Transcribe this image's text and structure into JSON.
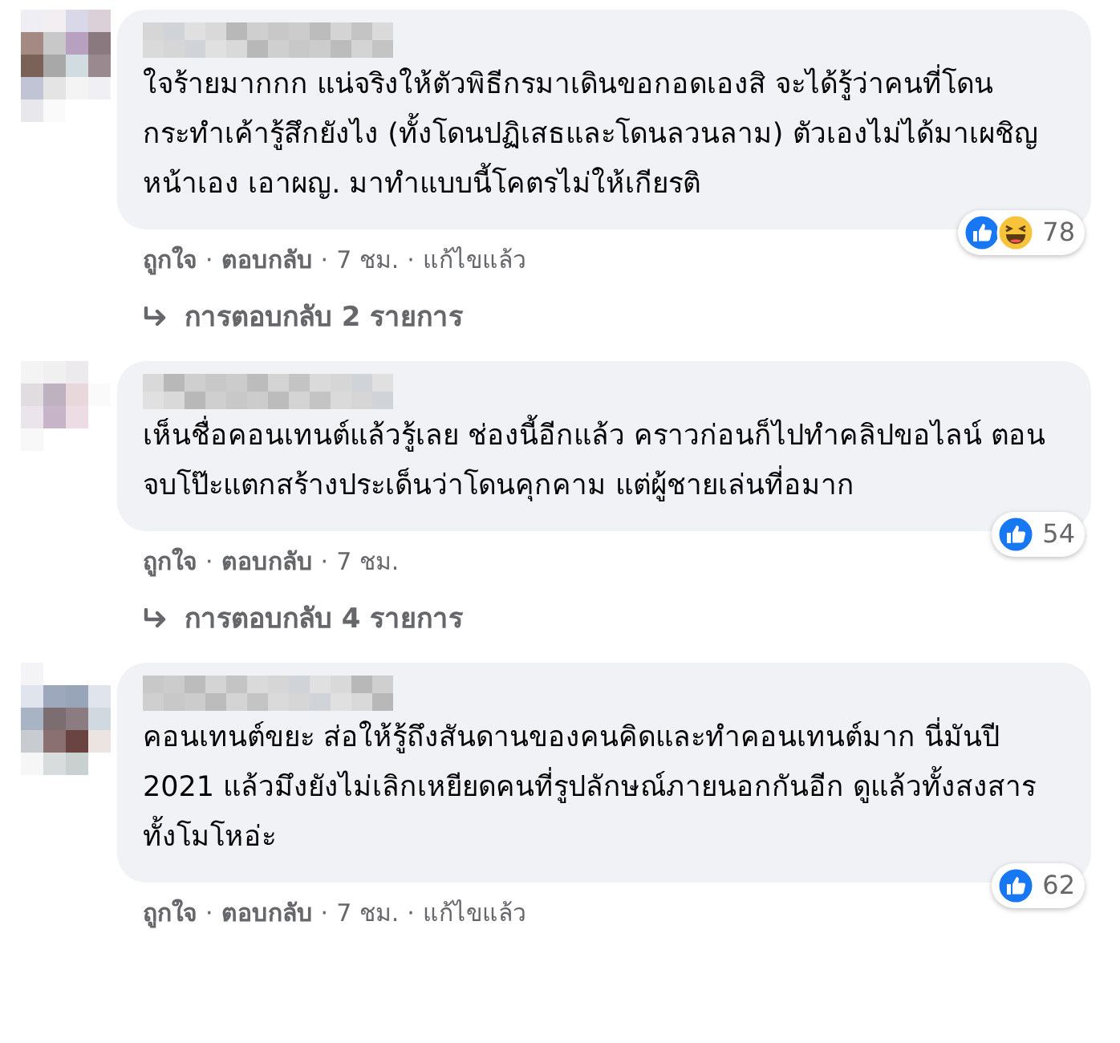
{
  "comments": [
    {
      "text": "ใจร้ายมากกก แน่จริงให้ตัวพิธีกรมาเดินขอกอดเองสิ จะได้รู้ว่าคนที่โดนกระทำเค้ารู้สึกยังไง (ทั้งโดนปฏิเสธและโดนลวนลาม) ตัวเองไม่ได้มาเผชิญหน้าเอง เอาผญ. มาทำแบบนี้โคตรไม่ให้เกียรติ",
      "reactions": [
        {
          "kind": "like"
        },
        {
          "kind": "haha"
        }
      ],
      "reaction_count": "78",
      "meta": [
        {
          "kind": "link",
          "text": "ถูกใจ"
        },
        {
          "kind": "sep",
          "text": "·"
        },
        {
          "kind": "link",
          "text": "ตอบกลับ"
        },
        {
          "kind": "sep",
          "text": "·"
        },
        {
          "kind": "time",
          "text": "7 ชม."
        },
        {
          "kind": "sep",
          "text": "·"
        },
        {
          "kind": "time",
          "text": "แก้ไขแล้ว"
        }
      ],
      "replies": "การตอบกลับ 2 รายการ"
    },
    {
      "text": "เห็นชื่อคอนเทนต์แล้วรู้เลย ช่องนี้อีกแล้ว คราวก่อนก็ไปทำคลิปขอไลน์ ตอนจบโป๊ะแตกสร้างประเด็นว่าโดนคุกคาม แต่ผู้ชายเล่นที่อมาก",
      "reactions": [
        {
          "kind": "like"
        }
      ],
      "reaction_count": "54",
      "meta": [
        {
          "kind": "link",
          "text": "ถูกใจ"
        },
        {
          "kind": "sep",
          "text": "·"
        },
        {
          "kind": "link",
          "text": "ตอบกลับ"
        },
        {
          "kind": "sep",
          "text": "·"
        },
        {
          "kind": "time",
          "text": "7 ชม."
        }
      ],
      "replies": "การตอบกลับ 4 รายการ"
    },
    {
      "text": "คอนเทนต์ขยะ ส่อให้รู้ถึงสันดานของคนคิดและทำคอนเทนต์มาก นี่มันปี 2021 แล้วมึงยังไม่เลิกเหยียดคนที่รูปลักษณ์ภายนอกกันอีก ดูแล้วทั้งสงสารทั้งโมโหอ่ะ",
      "reactions": [
        {
          "kind": "like"
        }
      ],
      "reaction_count": "62",
      "meta": [
        {
          "kind": "link",
          "text": "ถูกใจ"
        },
        {
          "kind": "sep",
          "text": "·"
        },
        {
          "kind": "link",
          "text": "ตอบกลับ"
        },
        {
          "kind": "sep",
          "text": "·"
        },
        {
          "kind": "time",
          "text": "7 ชม."
        },
        {
          "kind": "sep",
          "text": "·"
        },
        {
          "kind": "time",
          "text": "แก้ไขแล้ว"
        }
      ]
    }
  ]
}
